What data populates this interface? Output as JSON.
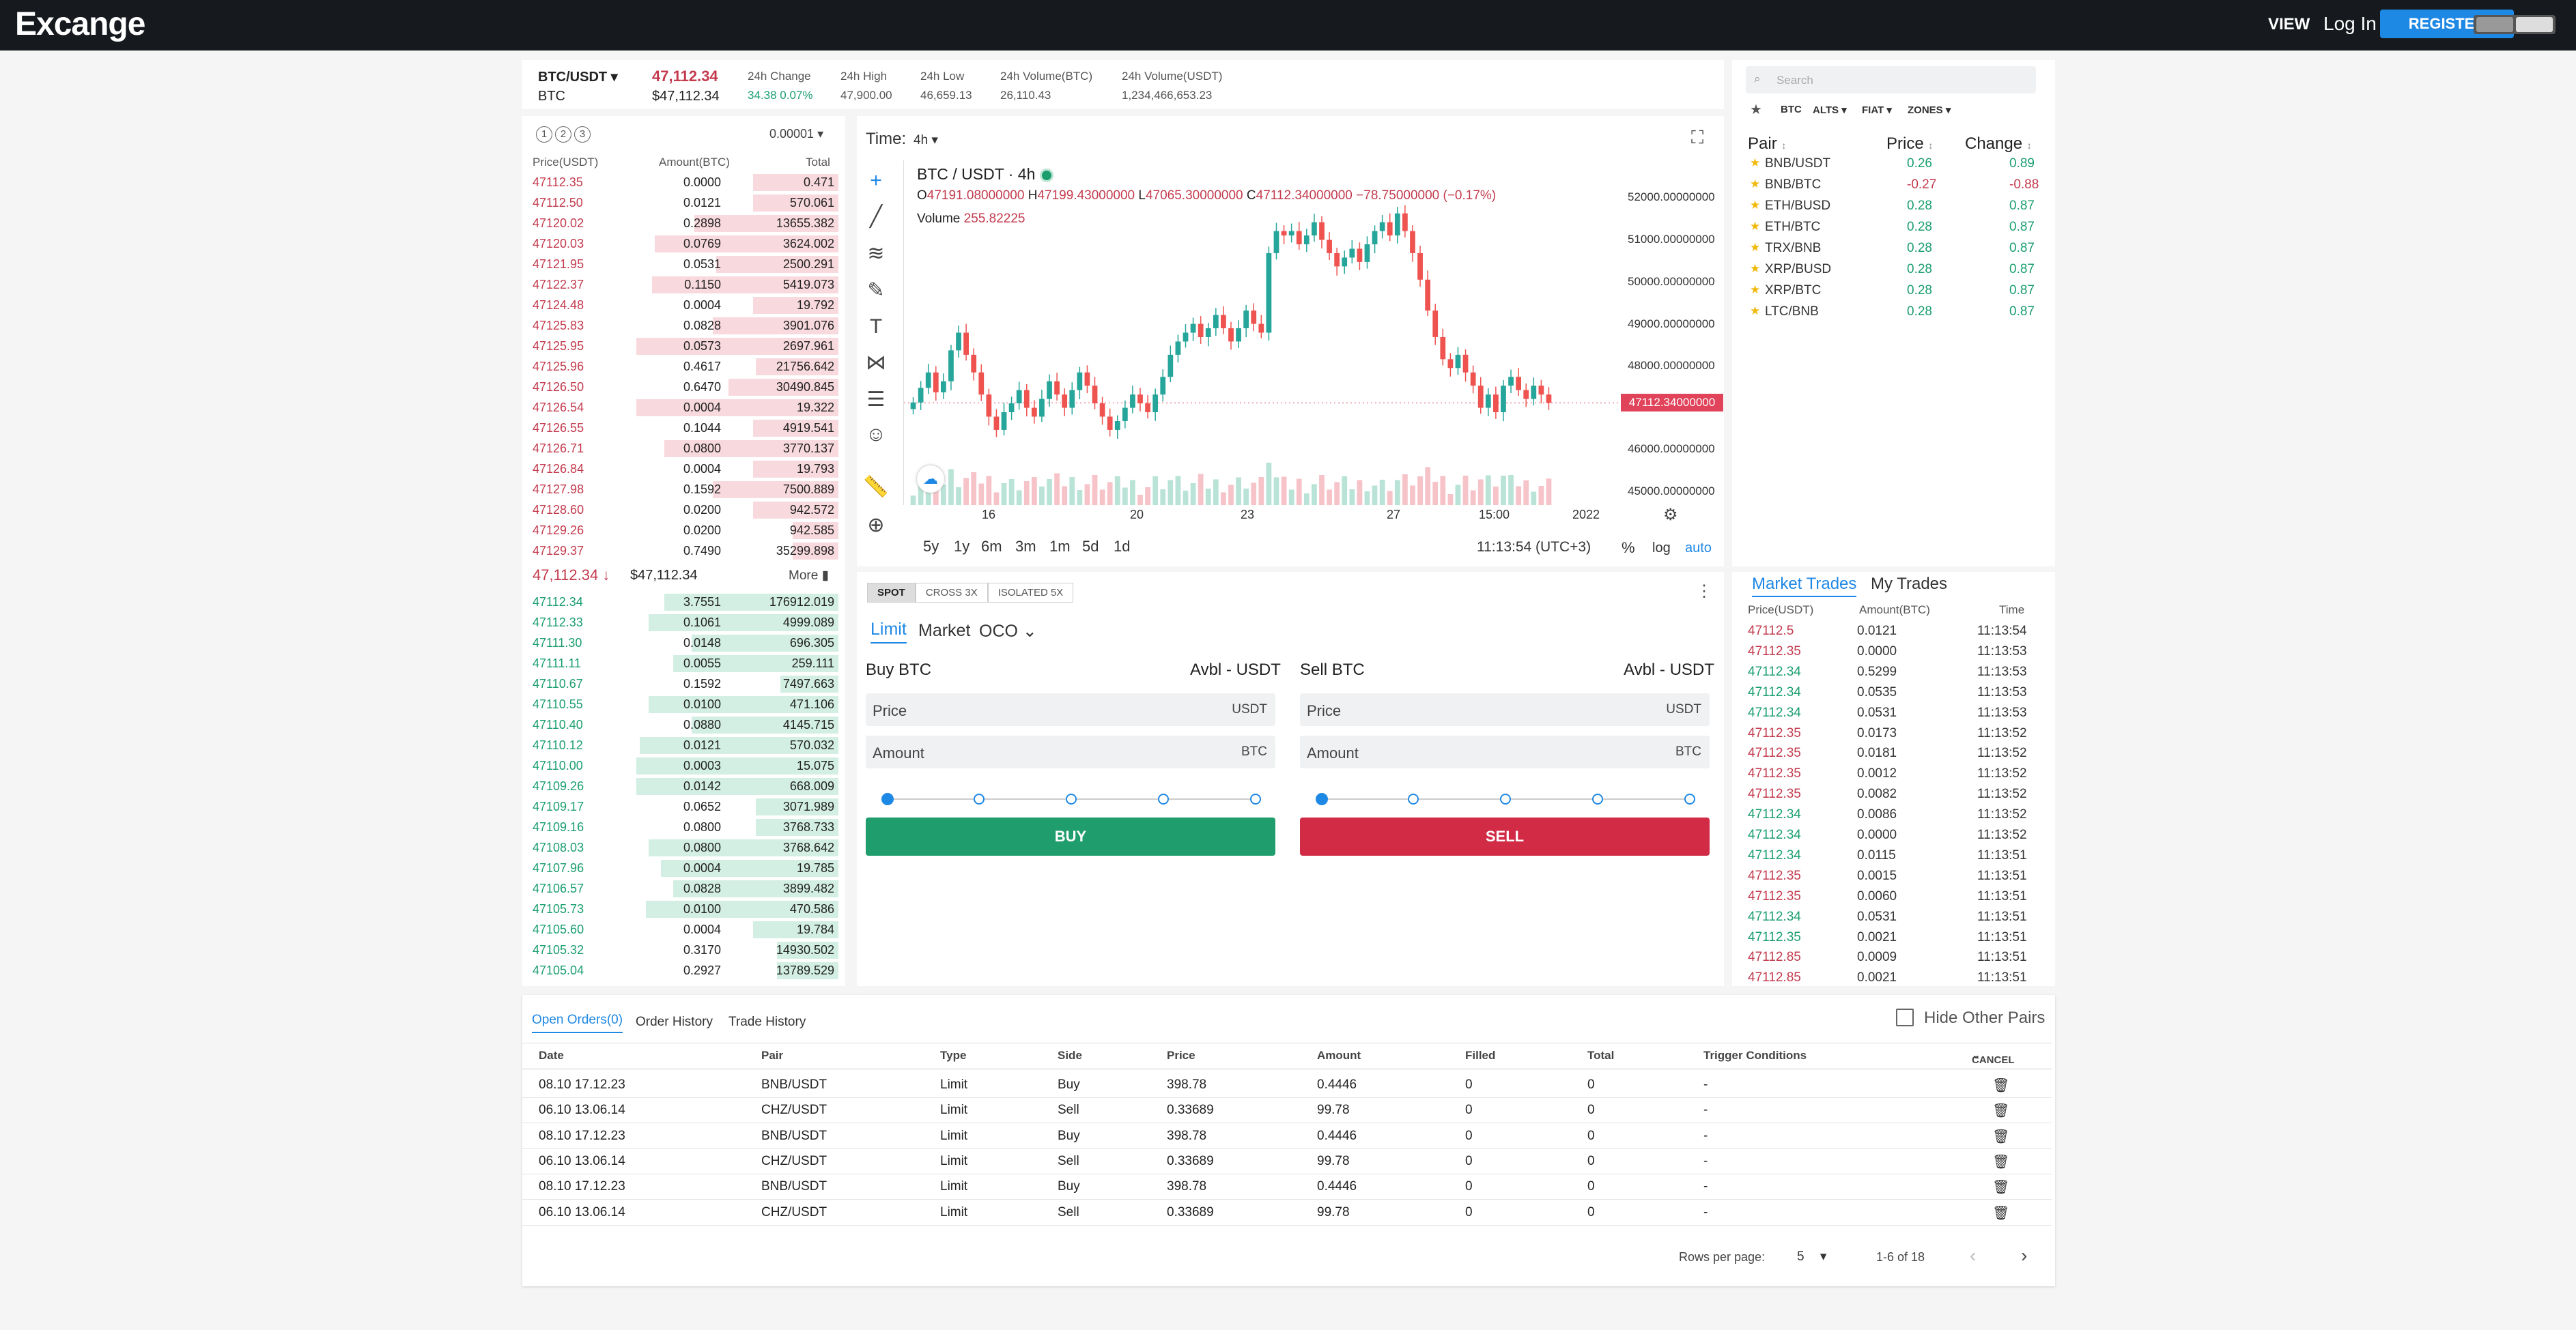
{
  "app": {
    "logo": "Excange"
  },
  "nav": {
    "view": "VIEW",
    "login": "Log In",
    "register": "REGISTER"
  },
  "ticker": {
    "pair": "BTC/USDT",
    "base": "BTC",
    "last_price": "47,112.34",
    "last_price_usd": "$47,112.34",
    "stats": [
      {
        "label": "24h Change",
        "value": "34.38 0.07%"
      },
      {
        "label": "24h High",
        "value": "47,900.00"
      },
      {
        "label": "24h Low",
        "value": "46,659.13"
      },
      {
        "label": "24h Volume(BTC)",
        "value": "26,110.43"
      },
      {
        "label": "24h Volume(USDT)",
        "value": "1,234,466,653.23"
      }
    ]
  },
  "orderbook": {
    "tabs": [
      "1",
      "2",
      "3"
    ],
    "precision": "0.00001",
    "headers": {
      "price": "Price(USDT)",
      "amount": "Amount(BTC)",
      "total": "Total"
    },
    "asks": [
      {
        "p": "47112.35",
        "a": "0.0000",
        "t": "0.471",
        "d": 0.28
      },
      {
        "p": "47112.50",
        "a": "0.0121",
        "t": "570.061",
        "d": 0.28
      },
      {
        "p": "47120.02",
        "a": "0.2898",
        "t": "13655.382",
        "d": 0.47
      },
      {
        "p": "47120.03",
        "a": "0.0769",
        "t": "3624.002",
        "d": 0.6
      },
      {
        "p": "47121.95",
        "a": "0.0531",
        "t": "2500.291",
        "d": 0.4
      },
      {
        "p": "47122.37",
        "a": "0.1150",
        "t": "5419.073",
        "d": 0.61
      },
      {
        "p": "47124.48",
        "a": "0.0004",
        "t": "19.792",
        "d": 0.28
      },
      {
        "p": "47125.83",
        "a": "0.0828",
        "t": "3901.076",
        "d": 0.41
      },
      {
        "p": "47125.95",
        "a": "0.0573",
        "t": "2697.961",
        "d": 0.66
      },
      {
        "p": "47125.96",
        "a": "0.4617",
        "t": "21756.642",
        "d": 0.27
      },
      {
        "p": "47126.50",
        "a": "0.6470",
        "t": "30490.845",
        "d": 0.36
      },
      {
        "p": "47126.54",
        "a": "0.0004",
        "t": "19.322",
        "d": 0.66
      },
      {
        "p": "47126.55",
        "a": "0.1044",
        "t": "4919.541",
        "d": 0.28
      },
      {
        "p": "47126.71",
        "a": "0.0800",
        "t": "3770.137",
        "d": 0.57
      },
      {
        "p": "47126.84",
        "a": "0.0004",
        "t": "19.793",
        "d": 0.28
      },
      {
        "p": "47127.98",
        "a": "0.1592",
        "t": "7500.889",
        "d": 0.41
      },
      {
        "p": "47128.60",
        "a": "0.0200",
        "t": "942.572",
        "d": 0.28
      },
      {
        "p": "47129.26",
        "a": "0.0200",
        "t": "942.585",
        "d": 0.15
      },
      {
        "p": "47129.37",
        "a": "0.7490",
        "t": "35299.898",
        "d": 0.15
      }
    ],
    "mid_price": "47,112.34",
    "mid_usd": "$47,112.34",
    "more": "More",
    "bids": [
      {
        "p": "47112.34",
        "a": "3.7551",
        "t": "176912.019",
        "d": 0.57
      },
      {
        "p": "47112.33",
        "a": "0.1061",
        "t": "4999.089",
        "d": 0.62
      },
      {
        "p": "47111.30",
        "a": "0.0148",
        "t": "696.305",
        "d": 0.48
      },
      {
        "p": "47111.11",
        "a": "0.0055",
        "t": "259.111",
        "d": 0.54
      },
      {
        "p": "47110.67",
        "a": "0.1592",
        "t": "7497.663",
        "d": 0.19
      },
      {
        "p": "47110.55",
        "a": "0.0100",
        "t": "471.106",
        "d": 0.62
      },
      {
        "p": "47110.40",
        "a": "0.0880",
        "t": "4145.715",
        "d": 0.48
      },
      {
        "p": "47110.12",
        "a": "0.0121",
        "t": "570.032",
        "d": 0.65
      },
      {
        "p": "47110.00",
        "a": "0.0003",
        "t": "15.075",
        "d": 0.66
      },
      {
        "p": "47109.26",
        "a": "0.0142",
        "t": "668.009",
        "d": 0.66
      },
      {
        "p": "47109.17",
        "a": "0.0652",
        "t": "3071.989",
        "d": 0.27
      },
      {
        "p": "47109.16",
        "a": "0.0800",
        "t": "3768.733",
        "d": 0.27
      },
      {
        "p": "47108.03",
        "a": "0.0800",
        "t": "3768.642",
        "d": 0.62
      },
      {
        "p": "47107.96",
        "a": "0.0004",
        "t": "19.785",
        "d": 0.58
      },
      {
        "p": "47106.57",
        "a": "0.0828",
        "t": "3899.482",
        "d": 0.54
      },
      {
        "p": "47105.73",
        "a": "0.0100",
        "t": "470.586",
        "d": 0.63
      },
      {
        "p": "47105.60",
        "a": "0.0004",
        "t": "19.784",
        "d": 0.28
      },
      {
        "p": "47105.32",
        "a": "0.3170",
        "t": "14930.502",
        "d": 0.2
      },
      {
        "p": "47105.04",
        "a": "0.2927",
        "t": "13789.529",
        "d": 0.2
      }
    ]
  },
  "chart": {
    "time_label": "Time:",
    "interval": "4h",
    "legend": {
      "symbol": "BTC / USDT · 4h",
      "o_label": "O",
      "o": "47191.08000000",
      "h_label": "H",
      "h": "47199.43000000",
      "l_label": "L",
      "l": "47065.30000000",
      "c_label": "C",
      "c": "47112.34000000",
      "chg": "−78.75000000 (−0.17%)",
      "volume_label": "Volume",
      "volume": "255.82225"
    },
    "y_ticks": [
      "52000.00000000",
      "51000.00000000",
      "50000.00000000",
      "49000.00000000",
      "48000.00000000",
      "46000.00000000",
      "45000.00000000"
    ],
    "price_tag": "47112.34000000",
    "x_ticks": [
      "16",
      "20",
      "23",
      "27",
      "15:00",
      "2022"
    ],
    "timeframes": [
      "5y",
      "1y",
      "6m",
      "3m",
      "1m",
      "5d",
      "1d"
    ],
    "clock": "11:13:54 (UTC+3)",
    "opts": {
      "pct": "%",
      "log": "log",
      "auto": "auto"
    }
  },
  "chart_data": {
    "type": "candlestick",
    "ylim": [
      44800,
      52600
    ],
    "candles": [
      47120,
      47450,
      47800,
      47350,
      47600,
      48300,
      48700,
      48200,
      47800,
      47300,
      46800,
      46500,
      46900,
      47100,
      47400,
      47000,
      46800,
      47200,
      47600,
      47300,
      47000,
      47400,
      47800,
      47500,
      47100,
      46800,
      46500,
      46700,
      47000,
      47300,
      47100,
      46900,
      47300,
      47700,
      48200,
      48500,
      48700,
      48900,
      48600,
      48800,
      49100,
      48800,
      48500,
      48800,
      49200,
      48900,
      48700,
      50500,
      51000,
      50900,
      51000,
      50700,
      50900,
      51200,
      50800,
      50500,
      50200,
      50400,
      50600,
      50300,
      50700,
      51000,
      51200,
      50900,
      51400,
      51000,
      50500,
      49900,
      49200,
      48600,
      48100,
      47900,
      48200,
      47800,
      47500,
      47000,
      47300,
      46900,
      47500,
      47700,
      47400,
      47200,
      47500,
      47300,
      47112
    ]
  },
  "trade": {
    "modes": [
      "SPOT",
      "CROSS 3X",
      "ISOLATED 5X"
    ],
    "order_types": [
      "Limit",
      "Market",
      "OCO"
    ],
    "buy": {
      "title": "Buy BTC",
      "avbl": "Avbl - USDT",
      "price_label": "Price",
      "price_unit": "USDT",
      "amount_label": "Amount",
      "amount_unit": "BTC",
      "button": "BUY"
    },
    "sell": {
      "title": "Sell BTC",
      "avbl": "Avbl - USDT",
      "price_label": "Price",
      "price_unit": "USDT",
      "amount_label": "Amount",
      "amount_unit": "BTC",
      "button": "SELL"
    }
  },
  "markets": {
    "search_placeholder": "Search",
    "filters": [
      "BTC",
      "ALTS",
      "FIAT",
      "ZONES"
    ],
    "headers": {
      "pair": "Pair",
      "price": "Price",
      "change": "Change"
    },
    "pairs": [
      {
        "pair": "BNB/USDT",
        "price": "0.26",
        "change": "0.89",
        "up": true
      },
      {
        "pair": "BNB/BTC",
        "price": "-0.27",
        "change": "-0.88",
        "up": false
      },
      {
        "pair": "ETH/BUSD",
        "price": "0.28",
        "change": "0.87",
        "up": true
      },
      {
        "pair": "ETH/BTC",
        "price": "0.28",
        "change": "0.87",
        "up": true
      },
      {
        "pair": "TRX/BNB",
        "price": "0.28",
        "change": "0.87",
        "up": true
      },
      {
        "pair": "XRP/BUSD",
        "price": "0.28",
        "change": "0.87",
        "up": true
      },
      {
        "pair": "XRP/BTC",
        "price": "0.28",
        "change": "0.87",
        "up": true
      },
      {
        "pair": "LTC/BNB",
        "price": "0.28",
        "change": "0.87",
        "up": true
      }
    ]
  },
  "trades": {
    "tabs": [
      "Market Trades",
      "My Trades"
    ],
    "headers": {
      "price": "Price(USDT)",
      "amount": "Amount(BTC)",
      "time": "Time"
    },
    "rows": [
      {
        "p": "47112.5",
        "a": "0.0121",
        "t": "11:13:54",
        "up": false
      },
      {
        "p": "47112.35",
        "a": "0.0000",
        "t": "11:13:53",
        "up": false
      },
      {
        "p": "47112.34",
        "a": "0.5299",
        "t": "11:13:53",
        "up": true
      },
      {
        "p": "47112.34",
        "a": "0.0535",
        "t": "11:13:53",
        "up": true
      },
      {
        "p": "47112.34",
        "a": "0.0531",
        "t": "11:13:53",
        "up": true
      },
      {
        "p": "47112.35",
        "a": "0.0173",
        "t": "11:13:52",
        "up": false
      },
      {
        "p": "47112.35",
        "a": "0.0181",
        "t": "11:13:52",
        "up": false
      },
      {
        "p": "47112.35",
        "a": "0.0012",
        "t": "11:13:52",
        "up": false
      },
      {
        "p": "47112.35",
        "a": "0.0082",
        "t": "11:13:52",
        "up": false
      },
      {
        "p": "47112.34",
        "a": "0.0086",
        "t": "11:13:52",
        "up": true
      },
      {
        "p": "47112.34",
        "a": "0.0000",
        "t": "11:13:52",
        "up": true
      },
      {
        "p": "47112.34",
        "a": "0.0115",
        "t": "11:13:51",
        "up": true
      },
      {
        "p": "47112.35",
        "a": "0.0015",
        "t": "11:13:51",
        "up": false
      },
      {
        "p": "47112.35",
        "a": "0.0060",
        "t": "11:13:51",
        "up": false
      },
      {
        "p": "47112.34",
        "a": "0.0531",
        "t": "11:13:51",
        "up": true
      },
      {
        "p": "47112.35",
        "a": "0.0021",
        "t": "11:13:51",
        "up": true
      },
      {
        "p": "47112.85",
        "a": "0.0009",
        "t": "11:13:51",
        "up": false
      },
      {
        "p": "47112.85",
        "a": "0.0021",
        "t": "11:13:51",
        "up": false
      }
    ]
  },
  "orders": {
    "tabs": [
      "Open Orders(0)",
      "Order History",
      "Trade History"
    ],
    "hide_other": "Hide Other Pairs",
    "headers": [
      "Date",
      "Pair",
      "Type",
      "Side",
      "Price",
      "Amount",
      "Filled",
      "Total",
      "Trigger Conditions",
      "CANCEL"
    ],
    "rows": [
      [
        "08.10 17.12.23",
        "BNB/USDT",
        "Limit",
        "Buy",
        "398.78",
        "0.4446",
        "0",
        "0",
        "-"
      ],
      [
        "06.10 13.06.14",
        "CHZ/USDT",
        "Limit",
        "Sell",
        "0.33689",
        "99.78",
        "0",
        "0",
        "-"
      ],
      [
        "08.10 17.12.23",
        "BNB/USDT",
        "Limit",
        "Buy",
        "398.78",
        "0.4446",
        "0",
        "0",
        "-"
      ],
      [
        "06.10 13.06.14",
        "CHZ/USDT",
        "Limit",
        "Sell",
        "0.33689",
        "99.78",
        "0",
        "0",
        "-"
      ],
      [
        "08.10 17.12.23",
        "BNB/USDT",
        "Limit",
        "Buy",
        "398.78",
        "0.4446",
        "0",
        "0",
        "-"
      ],
      [
        "06.10 13.06.14",
        "CHZ/USDT",
        "Limit",
        "Sell",
        "0.33689",
        "99.78",
        "0",
        "0",
        "-"
      ]
    ],
    "rows_per_page_label": "Rows per page:",
    "rows_per_page": "5",
    "range": "1-6 of 18"
  },
  "colors": {
    "up": "#1a9e6e",
    "down": "#c33a4d",
    "accent": "#1e88e5",
    "buy": "#1f9d6c",
    "sell": "#d12b46"
  }
}
